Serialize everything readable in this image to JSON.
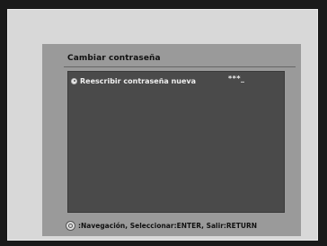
{
  "dialog": {
    "title": "Cambiar contraseña",
    "option_label": "Reescribir contraseña nueva",
    "password_value": "***_"
  },
  "footer": {
    "hint_text": ":Navegación, Seleccionar:ENTER, Salir:RETURN"
  },
  "icons": {
    "option": "radio-dot-icon",
    "navigation": "navigation-pad-icon"
  }
}
